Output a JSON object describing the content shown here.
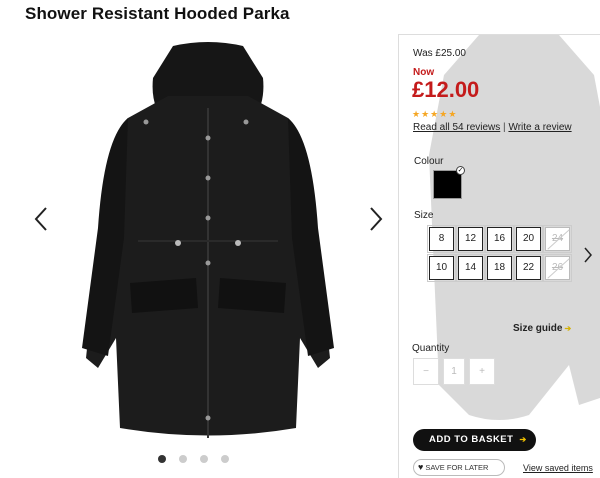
{
  "product": {
    "title": "Shower Resistant Hooded Parka"
  },
  "pricing": {
    "was": "Was £25.00",
    "now_label": "Now",
    "price": "£12.00"
  },
  "rating": {
    "stars": 5,
    "reviews_link": "Read all 54 reviews",
    "separator": "|",
    "write_link": "Write a review"
  },
  "colour": {
    "label": "Colour",
    "selected_color": "#000000"
  },
  "size": {
    "label": "Size",
    "options": [
      {
        "value": "8",
        "available": true
      },
      {
        "value": "12",
        "available": true
      },
      {
        "value": "16",
        "available": true
      },
      {
        "value": "20",
        "available": true
      },
      {
        "value": "24",
        "available": false
      },
      {
        "value": "10",
        "available": true
      },
      {
        "value": "14",
        "available": true
      },
      {
        "value": "18",
        "available": true
      },
      {
        "value": "22",
        "available": true
      },
      {
        "value": "26",
        "available": false
      }
    ],
    "guide_label": "Size guide"
  },
  "quantity": {
    "label": "Quantity",
    "minus": "−",
    "value": "1",
    "plus": "+"
  },
  "actions": {
    "add_to_basket": "ADD TO BASKET",
    "save_for_later": "SAVE FOR LATER",
    "view_saved": "View saved items"
  },
  "gallery": {
    "slide_count": 4,
    "active_slide": 1
  },
  "colors": {
    "price_red": "#c41b1b",
    "star_gold": "#f5a623"
  }
}
